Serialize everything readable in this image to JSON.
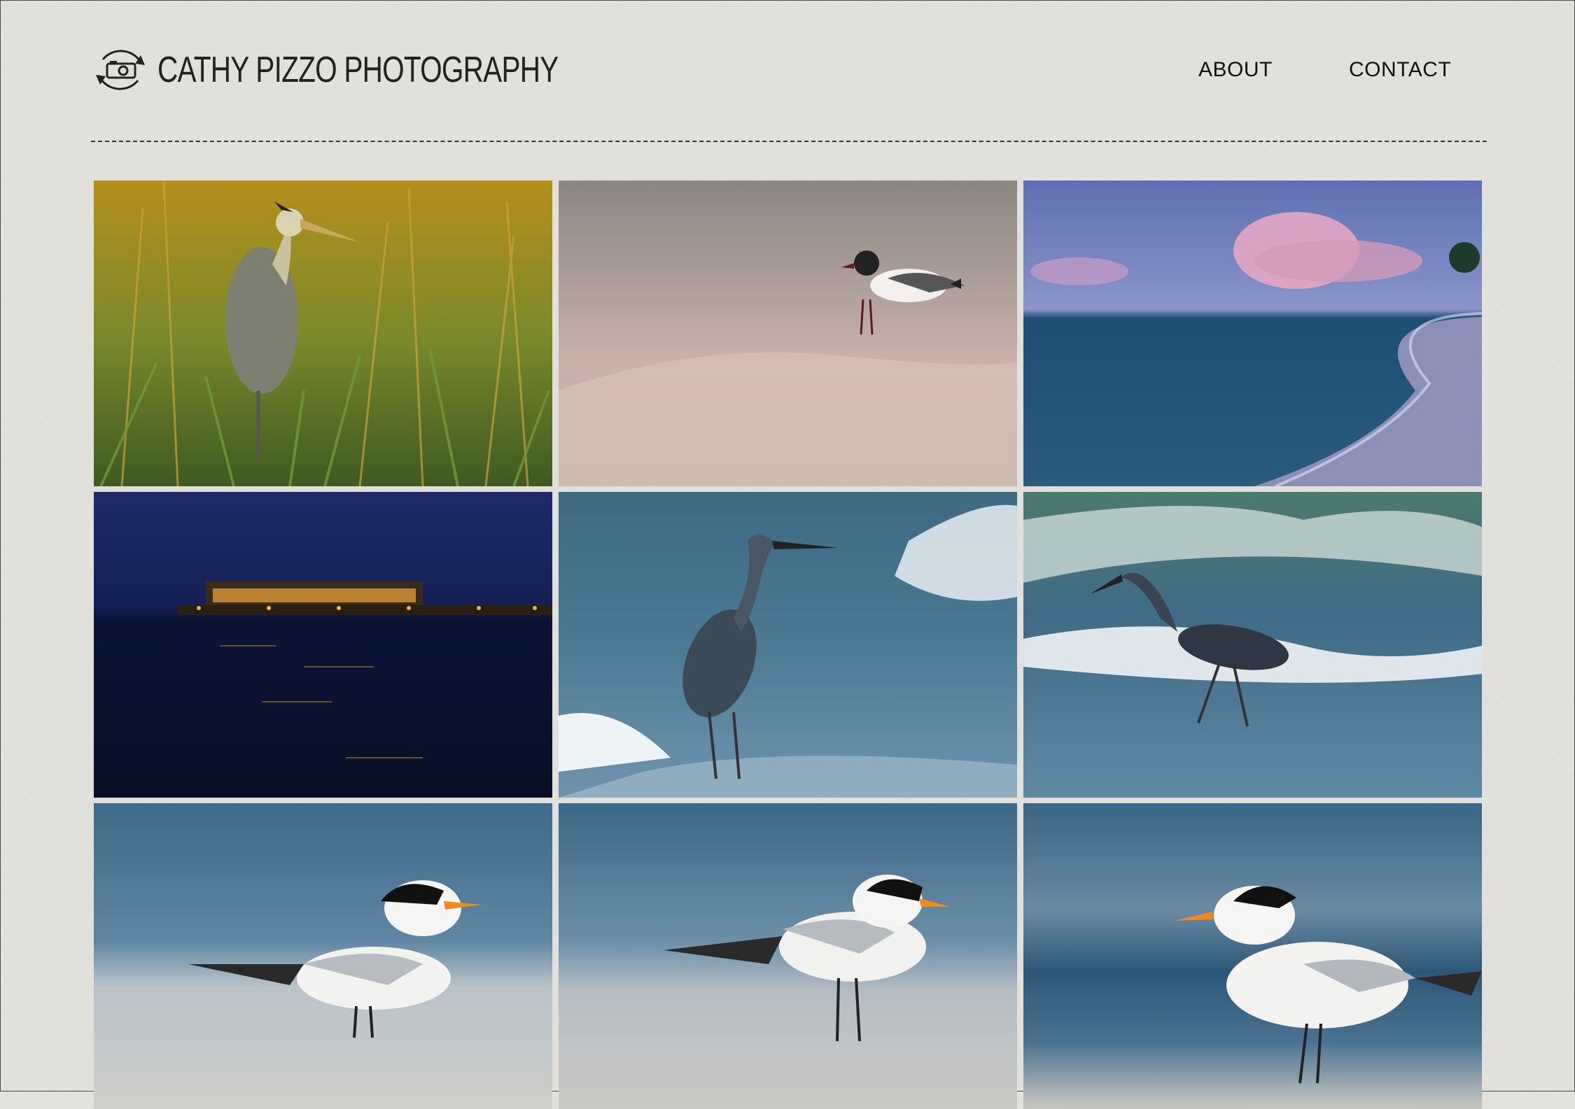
{
  "header": {
    "brand": "CATHY PIZZO PHOTOGRAPHY",
    "logo_icon": "rotating-camera-icon",
    "nav": [
      {
        "label": "ABOUT"
      },
      {
        "label": "CONTACT"
      }
    ]
  },
  "gallery": {
    "images": [
      {
        "subject": "great-blue-heron-in-sea-oats-photo"
      },
      {
        "subject": "laughing-gull-on-sand-photo"
      },
      {
        "subject": "sunset-clouds-over-beach-shoreline-photo"
      },
      {
        "subject": "lit-pier-at-night-photo"
      },
      {
        "subject": "reddish-egret-standing-in-surf-photo"
      },
      {
        "subject": "reddish-egret-walking-in-surf-photo"
      },
      {
        "subject": "royal-tern-facing-right-photo"
      },
      {
        "subject": "royal-tern-facing-right-second-photo"
      },
      {
        "subject": "royal-tern-facing-left-photo"
      }
    ]
  },
  "colors": {
    "page_background": "#e3e1dc",
    "text": "#111111"
  }
}
